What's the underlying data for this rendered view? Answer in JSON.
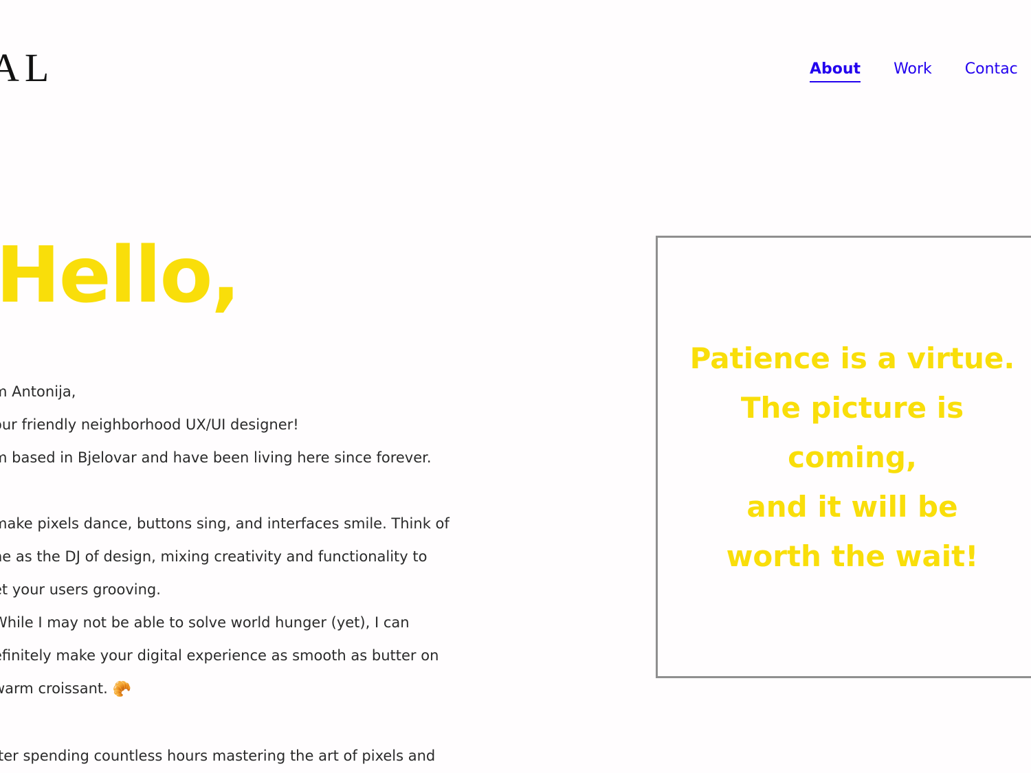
{
  "header": {
    "logo_text": "AL",
    "nav": [
      {
        "label": "About",
        "active": true
      },
      {
        "label": "Work",
        "active": false
      },
      {
        "label": "Contac",
        "active": false
      }
    ]
  },
  "hero": {
    "greeting": "Hello,",
    "bio_lines": [
      "m Antonija,",
      "our friendly neighborhood UX/UI designer!",
      "m based in Bjelovar and have been living here since forever.",
      "",
      "make pixels dance, buttons sing, and interfaces smile. Think of",
      "ne as the DJ of design, mixing creativity and functionality to",
      "et your users grooving.",
      "While I may not be able to solve world hunger (yet), I can",
      "efinitely make your digital experience as smooth as butter on",
      " warm croissant.",
      "",
      "fter spending countless hours mastering the art of pixels and"
    ],
    "croissant_emoji": "🥐"
  },
  "placeholder": {
    "lines": [
      "Patience is a virtue.",
      "The picture is",
      "coming,",
      "and it will be",
      "worth the wait!"
    ]
  },
  "colors": {
    "accent_yellow": "#f9de0a",
    "link_blue": "#2200ee",
    "text": "#2a2a2a",
    "border": "#8f8f8f",
    "background": "#fffdfe"
  }
}
